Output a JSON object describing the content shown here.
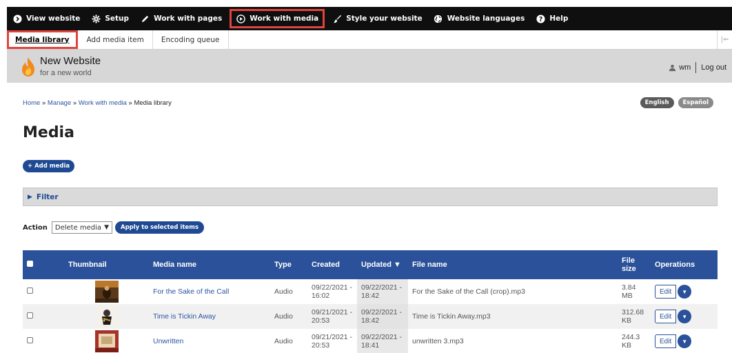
{
  "toolbar": {
    "items": [
      {
        "label": "View website",
        "icon": "circle-arrow-icon"
      },
      {
        "label": "Setup",
        "icon": "gear-icon"
      },
      {
        "label": "Work with pages",
        "icon": "pencil-icon"
      },
      {
        "label": "Work with media",
        "icon": "play-icon"
      },
      {
        "label": "Style your website",
        "icon": "brush-icon"
      },
      {
        "label": "Website languages",
        "icon": "globe-icon"
      },
      {
        "label": "Help",
        "icon": "help-icon"
      }
    ]
  },
  "tray": {
    "items": [
      "Media library",
      "Add media item",
      "Encoding queue"
    ]
  },
  "site": {
    "name": "New Website",
    "slogan": "for a new world",
    "user": "wm",
    "logout": "Log out"
  },
  "breadcrumb": {
    "home": "Home",
    "manage": "Manage",
    "work": "Work with media",
    "current": "Media library",
    "sep": "»"
  },
  "languages": [
    "English",
    "Español"
  ],
  "page_title": "Media",
  "add_media_label": "+ Add media",
  "filter_label": "Filter",
  "action": {
    "label": "Action",
    "selected": "Delete media",
    "apply": "Apply to selected items"
  },
  "table": {
    "headers": {
      "thumbnail": "Thumbnail",
      "name": "Media name",
      "type": "Type",
      "created": "Created",
      "updated": "Updated ▼",
      "file": "File name",
      "size_line1": "File",
      "size_line2": "size",
      "ops": "Operations"
    },
    "rows": [
      {
        "name": "For the Sake of the Call",
        "type": "Audio",
        "created": "09/22/2021 - 16:02",
        "updated": "09/22/2021 - 18:42",
        "file": "For the Sake of the Call (crop).mp3",
        "size": "3.84 MB",
        "edit": "Edit"
      },
      {
        "name": "Time is Tickin Away",
        "type": "Audio",
        "created": "09/21/2021 - 20:53",
        "updated": "09/22/2021 - 18:42",
        "file": "Time is Tickin Away.mp3",
        "size": "312.68 KB",
        "edit": "Edit"
      },
      {
        "name": "Unwritten",
        "type": "Audio",
        "created": "09/21/2021 - 20:53",
        "updated": "09/22/2021 - 18:41",
        "file": "unwritten 3.mp3",
        "size": "244.3 KB",
        "edit": "Edit"
      }
    ]
  },
  "colors": {
    "toolbar_bg": "#0f0f0f",
    "highlight": "#e0443e",
    "accent_blue": "#2a5199",
    "header_gray": "#d7d7d7"
  }
}
